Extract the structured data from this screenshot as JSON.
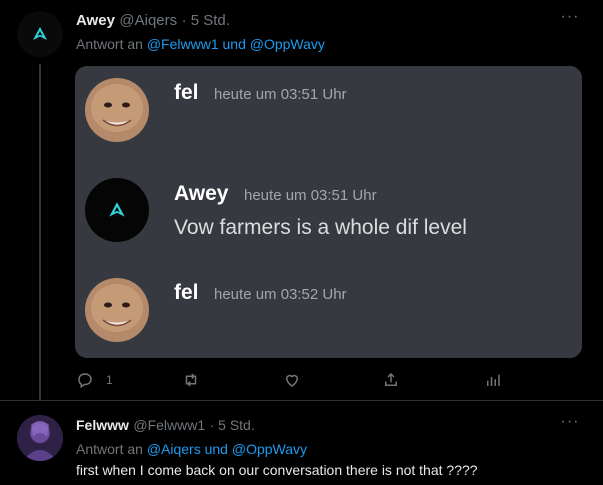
{
  "tweet1": {
    "name": "Awey",
    "handle": "@Aiqers",
    "time": "· 5 Std.",
    "reply_prefix": "Antwort an",
    "reply_targets": "@Felwww1 und @OppWavy",
    "more": "···"
  },
  "embed": {
    "messages": [
      {
        "author": "fel",
        "time": "heute um 03:51 Uhr",
        "text": ""
      },
      {
        "author": "Awey",
        "time": "heute um 03:51 Uhr",
        "text": "Vow farmers is a whole dif level"
      },
      {
        "author": "fel",
        "time": "heute um 03:52 Uhr",
        "text": ""
      }
    ]
  },
  "actions": {
    "reply_count": "1",
    "icons": [
      "reply-icon",
      "retweet-icon",
      "like-icon",
      "share-icon",
      "analytics-icon"
    ]
  },
  "tweet2": {
    "name": "Felwww",
    "handle": "@Felwww1",
    "time": "· 5 Std.",
    "reply_prefix": "Antwort an",
    "reply_targets": "@Aiqers und @OppWavy",
    "text": "first when I come back on our conversation there is not that ????",
    "more": "···"
  },
  "colors": {
    "background": "#000000",
    "link": "#1d9bf0",
    "muted": "#71767b",
    "embed_bg": "#36393f",
    "logo_cyan": "#2fd5d9"
  }
}
